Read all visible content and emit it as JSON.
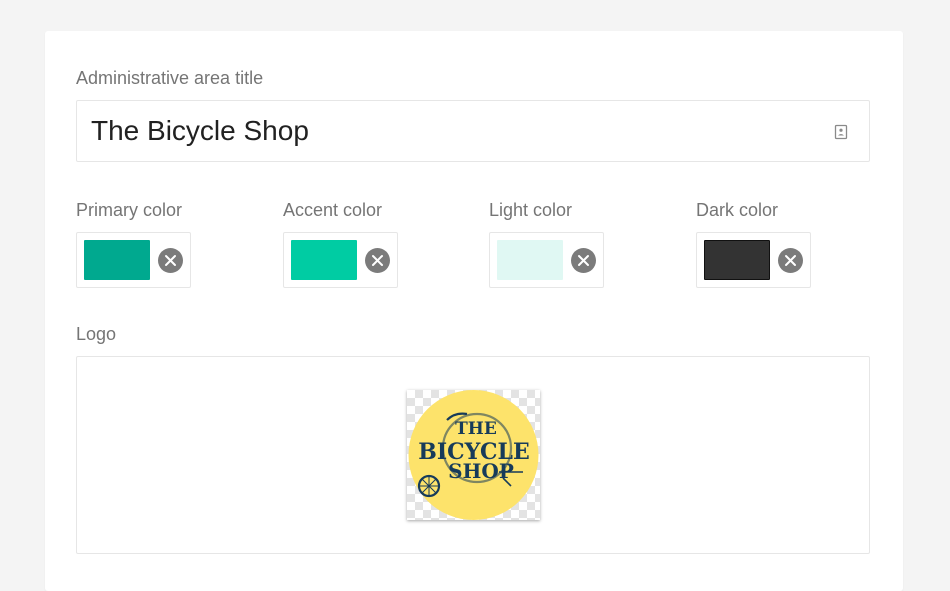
{
  "title_field": {
    "label": "Administrative area title",
    "value": "The Bicycle Shop"
  },
  "colors": [
    {
      "label": "Primary color",
      "hex": "#00a98f"
    },
    {
      "label": "Accent color",
      "hex": "#00cca3"
    },
    {
      "label": "Light color",
      "hex": "#e0f8f3"
    },
    {
      "label": "Dark color",
      "hex": "#333333"
    }
  ],
  "logo": {
    "label": "Logo",
    "text_top": "THE",
    "text_middle": "BICYCLE",
    "text_bottom": "SHOP",
    "circle_color": "#fde36b",
    "ink_color": "#173b5a"
  },
  "icons": {
    "input_trailing": "contact-card-icon",
    "clear": "close-icon"
  }
}
